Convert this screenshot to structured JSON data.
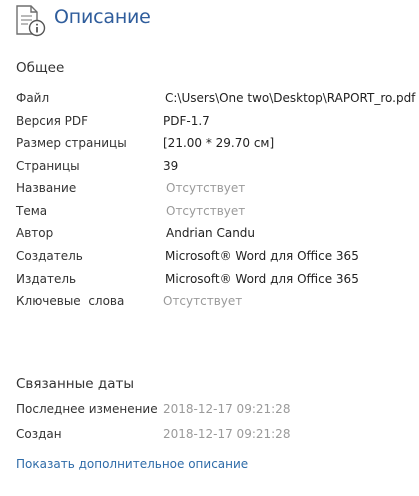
{
  "header": {
    "title": "Описание",
    "icon": "document-info-icon"
  },
  "general": {
    "title": "Общее",
    "rows": [
      {
        "label": "Файл",
        "value": "C:\\Users\\One two\\Desktop\\RAPORT_ro.pdf",
        "muted": false
      },
      {
        "label": "Версия PDF",
        "value": "PDF-1.7",
        "muted": false
      },
      {
        "label": "Размер страницы",
        "value": "[21.00 * 29.70 см]",
        "muted": false
      },
      {
        "label": "Страницы",
        "value": "39",
        "muted": false
      },
      {
        "label": "Название",
        "value": "Отсутствует",
        "muted": true
      },
      {
        "label": "Тема",
        "value": "Отсутствует",
        "muted": true
      },
      {
        "label": "Автор",
        "value": "Andrian Candu",
        "muted": false
      },
      {
        "label": "Создатель",
        "value": "Microsoft® Word для Office 365",
        "muted": false
      },
      {
        "label": "Издатель",
        "value": "Microsoft® Word для Office 365",
        "muted": false
      },
      {
        "label": "Ключевые  слова",
        "value": "Отсутствует",
        "muted": true
      }
    ]
  },
  "dates": {
    "title": "Связанные даты",
    "rows": [
      {
        "label": "Последнее изменение",
        "value": "2018-12-17 09:21:28",
        "muted": true
      },
      {
        "label": "Создан",
        "value": "2018-12-17 09:21:28",
        "muted": true
      }
    ]
  },
  "more_link": "Показать дополнительное описание",
  "colors": {
    "accent": "#2f5d9c",
    "link": "#2e6ba8",
    "muted": "#9a9a9a"
  }
}
